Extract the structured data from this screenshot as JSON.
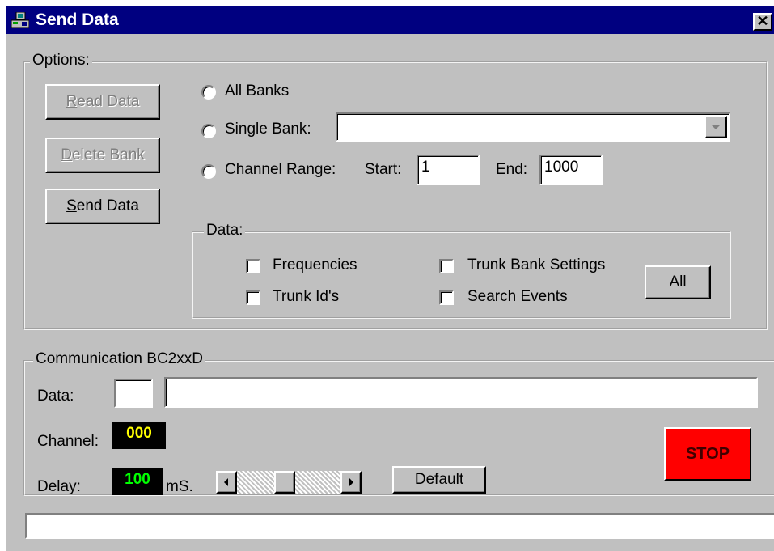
{
  "window": {
    "title": "Send Data",
    "close_glyph": "✕",
    "icon": "app-icon"
  },
  "options": {
    "legend": "Options:",
    "buttons": {
      "read": {
        "prefix": "",
        "key": "R",
        "rest": "ead Data"
      },
      "delete": {
        "prefix": "",
        "key": "D",
        "rest": "elete Bank"
      },
      "send": {
        "prefix": "",
        "key": "S",
        "rest": "end Data"
      }
    },
    "radios": {
      "all_banks": "All Banks",
      "single_bank": "Single Bank:",
      "channel_range": "Channel Range:"
    },
    "single_bank_value": "",
    "start_label": "Start:",
    "start_value": "1",
    "end_label": "End:",
    "end_value": "1000",
    "data": {
      "legend": "Data:",
      "frequencies": "Frequencies",
      "trunk_ids": "Trunk Id's",
      "trunk_bank_settings": "Trunk Bank Settings",
      "search_events": "Search Events",
      "all_button": "All"
    }
  },
  "communication": {
    "legend": "Communication BC2xxD",
    "data_label": "Data:",
    "data_small_value": "",
    "data_value": "",
    "channel_label": "Channel:",
    "channel_value": "000",
    "delay_label": "Delay:",
    "delay_value": "100",
    "delay_unit": "mS.",
    "default_button": "Default",
    "stop_button": "STOP",
    "delay_slider_fraction": 0.45
  },
  "status_bar": {
    "text": ""
  },
  "colors": {
    "titlebar": "#000080",
    "face": "#c0c0c0",
    "channel_led": "#ffff00",
    "delay_led": "#00ff00",
    "stop": "#ff0000"
  }
}
